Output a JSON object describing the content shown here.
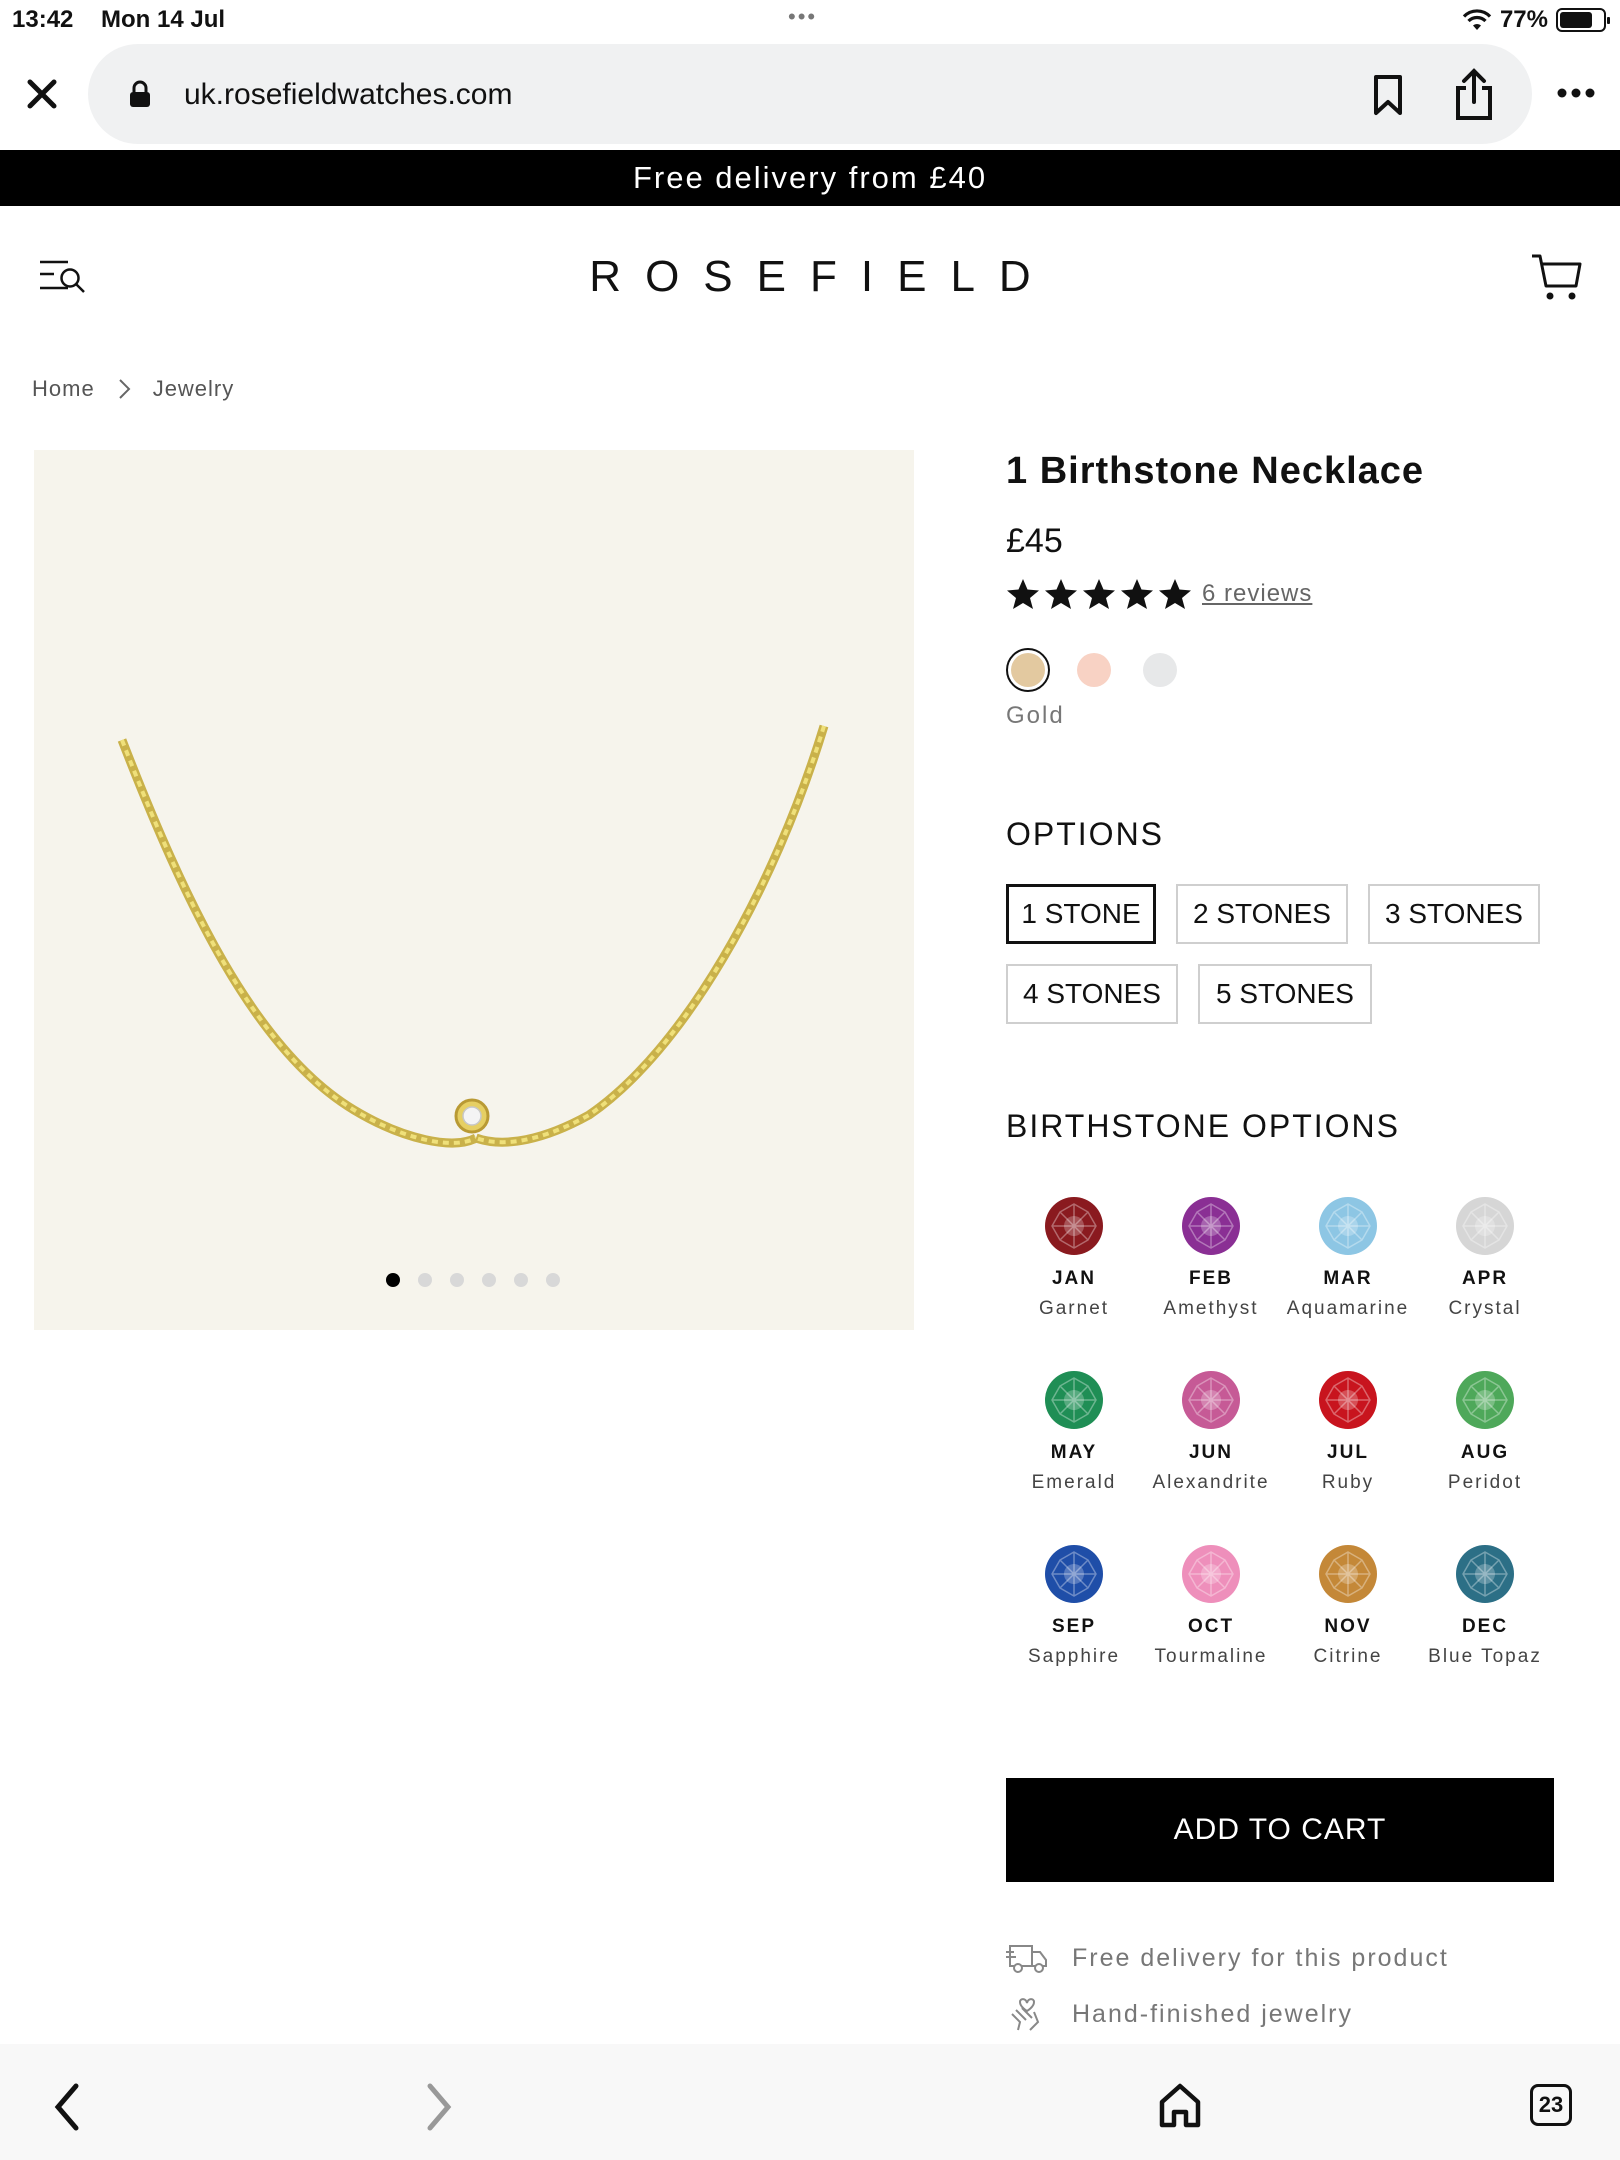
{
  "status": {
    "time": "13:42",
    "date": "Mon 14 Jul",
    "battery": "77%",
    "battery_level": 0.77
  },
  "browser": {
    "url": "uk.rosefieldwatches.com",
    "tab_count": "23"
  },
  "promo": {
    "text": "Free delivery from £40"
  },
  "header": {
    "logo": "ROSEFIELD"
  },
  "breadcrumb": [
    {
      "label": "Home"
    },
    {
      "label": "Jewelry"
    }
  ],
  "gallery": {
    "image_count": 6,
    "active_index": 0
  },
  "product": {
    "title": "1 Birthstone Necklace",
    "price": "£45",
    "rating": 5,
    "reviews": "6 reviews",
    "colors": [
      {
        "name": "gold",
        "color": "#e3c9a0",
        "selected": true
      },
      {
        "name": "rose",
        "color": "#f8d2c4",
        "selected": false
      },
      {
        "name": "silver",
        "color": "#e7e8e9",
        "selected": false
      }
    ],
    "selected_color_label": "Gold"
  },
  "options": {
    "heading": "OPTIONS",
    "items": [
      {
        "label": "1 STONE",
        "selected": true
      },
      {
        "label": "2 STONES",
        "selected": false
      },
      {
        "label": "3 STONES",
        "selected": false
      },
      {
        "label": "4 STONES",
        "selected": false
      },
      {
        "label": "5 STONES",
        "selected": false
      }
    ]
  },
  "birthstones": {
    "heading": "BIRTHSTONE OPTIONS",
    "items": [
      {
        "month": "JAN",
        "name": "Garnet",
        "color": "#8a1a1f"
      },
      {
        "month": "FEB",
        "name": "Amethyst",
        "color": "#8a2f94"
      },
      {
        "month": "MAR",
        "name": "Aquamarine",
        "color": "#8dc6e4"
      },
      {
        "month": "APR",
        "name": "Crystal",
        "color": "#d6d6d6"
      },
      {
        "month": "MAY",
        "name": "Emerald",
        "color": "#1f8e55"
      },
      {
        "month": "JUN",
        "name": "Alexandrite",
        "color": "#c65a96"
      },
      {
        "month": "JUL",
        "name": "Ruby",
        "color": "#c8141e"
      },
      {
        "month": "AUG",
        "name": "Peridot",
        "color": "#4ea85a"
      },
      {
        "month": "SEP",
        "name": "Sapphire",
        "color": "#1f4ea8"
      },
      {
        "month": "OCT",
        "name": "Tourmaline",
        "color": "#ee8fbb"
      },
      {
        "month": "NOV",
        "name": "Citrine",
        "color": "#c48838"
      },
      {
        "month": "DEC",
        "name": "Blue Topaz",
        "color": "#2c6f86"
      }
    ]
  },
  "cart": {
    "add_label": "ADD TO CART"
  },
  "perks": [
    {
      "icon": "delivery-truck-icon",
      "text": "Free delivery for this product"
    },
    {
      "icon": "hand-heart-icon",
      "text": "Hand-finished jewelry"
    }
  ]
}
